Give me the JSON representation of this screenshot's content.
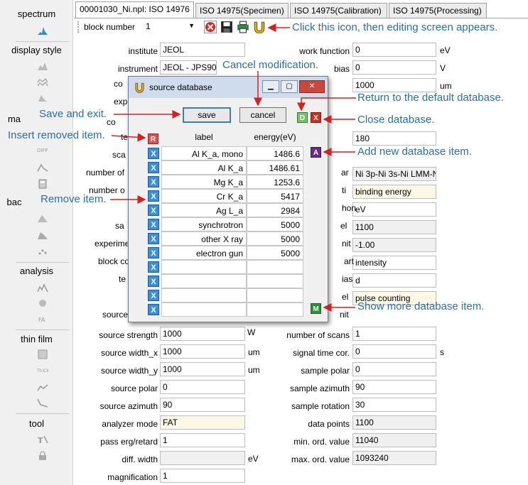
{
  "sidebar": {
    "sections": [
      {
        "title": "spectrum"
      },
      {
        "title": "display style"
      },
      {
        "title": "ma"
      },
      {
        "title": "bac"
      },
      {
        "title": "analysis"
      },
      {
        "title": "thin film"
      },
      {
        "title": "tool"
      }
    ]
  },
  "tabs": [
    {
      "label": "00001030_Ni.npl: ISO 14976"
    },
    {
      "label": "ISO 14975(Specimen)"
    },
    {
      "label": "ISO 14975(Calibration)"
    },
    {
      "label": "ISO 14975(Processing)"
    }
  ],
  "toolbar": {
    "block_label": "block number",
    "block_value": "1"
  },
  "form": {
    "left": [
      {
        "label": "institute",
        "value": "JEOL"
      },
      {
        "label": "instrument",
        "value": "JEOL - JPS90"
      },
      {
        "label": "source strength",
        "value": "1000"
      },
      {
        "label": "source width_x",
        "value": "1000",
        "unit": "um"
      },
      {
        "label": "source width_y",
        "value": "1000",
        "unit": "um"
      },
      {
        "label": "source polar",
        "value": "0"
      },
      {
        "label": "source azimuth",
        "value": "90"
      },
      {
        "label": "analyzer mode",
        "value": "FAT"
      },
      {
        "label": "pass erg/retard",
        "value": "1"
      },
      {
        "label": "diff. width",
        "value": "",
        "unit": "eV"
      },
      {
        "label": "magnification",
        "value": "1"
      }
    ],
    "right": [
      {
        "label": "work function",
        "value": "0",
        "unit": "eV"
      },
      {
        "label": "bias",
        "value": "0",
        "unit": "V"
      },
      {
        "label": "",
        "value": "1000",
        "unit": "um"
      },
      {
        "label": "",
        "value": "180"
      },
      {
        "label": "",
        "value": "Ni 3p-Ni 3s-Ni LMM-N"
      },
      {
        "label": "",
        "value": "binding energy"
      },
      {
        "label": "",
        "value": "eV"
      },
      {
        "label": "",
        "value": "1100"
      },
      {
        "label": "",
        "value": "-1.00"
      },
      {
        "label": "",
        "value": "intensity"
      },
      {
        "label": "",
        "value": "d"
      },
      {
        "label": "",
        "value": "pulse counting"
      },
      {
        "label": "number of scans",
        "value": "1"
      },
      {
        "label": "signal time cor.",
        "value": "0",
        "unit": "s"
      },
      {
        "label": "sample polar",
        "value": "0"
      },
      {
        "label": "sample azimuth",
        "value": "90"
      },
      {
        "label": "sample rotation",
        "value": "30"
      },
      {
        "label": "data points",
        "value": "1100"
      },
      {
        "label": "min. ord. value",
        "value": "11040"
      },
      {
        "label": "max. ord. value",
        "value": "1093240"
      }
    ],
    "partial_labels": [
      "co",
      "exp",
      "co",
      "ter",
      "sca",
      "number of",
      "number o",
      "sa",
      "experime",
      "block co",
      "te",
      "source",
      "",
      "ou",
      "ue",
      "ar",
      "ti",
      "hon",
      "el",
      "nit",
      "art",
      "ias",
      "el",
      "nit",
      "de",
      "me"
    ],
    "units_extra": [
      "W"
    ]
  },
  "dialog": {
    "title": "source database",
    "save_label": "save",
    "cancel_label": "cancel",
    "columns": {
      "label": "label",
      "energy": "energy(eV)"
    },
    "rows": [
      {
        "label": "Al K_a, mono",
        "energy": "1486.6"
      },
      {
        "label": "Al K_a",
        "energy": "1486.61"
      },
      {
        "label": "Mg K_a",
        "energy": "1253.6"
      },
      {
        "label": "Cr K_a",
        "energy": "5417"
      },
      {
        "label": "Ag L_a",
        "energy": "2984"
      },
      {
        "label": "synchrotron",
        "energy": "5000"
      },
      {
        "label": "other X ray",
        "energy": "5000"
      },
      {
        "label": "electron gun",
        "energy": "5000"
      },
      {
        "label": "",
        "energy": ""
      },
      {
        "label": "",
        "energy": ""
      },
      {
        "label": "",
        "energy": ""
      },
      {
        "label": "",
        "energy": ""
      }
    ],
    "btn_letters": {
      "remove": "X",
      "restore": "R",
      "default": "D",
      "close": "X",
      "add": "A",
      "more": "M"
    }
  },
  "annotations": {
    "edit": "Click this icon, then editing screen appears.",
    "cancel": "Cancel modification.",
    "default": "Return to the default database.",
    "save": "Save and exit.",
    "close": "Close database.",
    "insert": "Insert removed item.",
    "add": "Add new database item.",
    "remove": "Remove item.",
    "more": "Show more database item."
  },
  "colors": {
    "annotation": "#2b6fa8",
    "arrow": "#d42020"
  }
}
